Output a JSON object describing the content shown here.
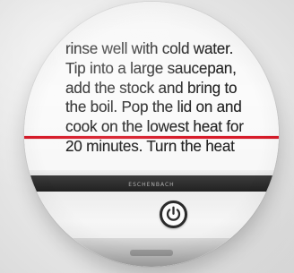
{
  "screen": {
    "lines": [
      "rinse well with cold water.",
      "Tip into a large saucepan,",
      "add the stock and bring to",
      "the boil. Pop the lid on and",
      "cook on the lowest heat for",
      "20 minutes. Turn the heat"
    ]
  },
  "device": {
    "brand": "ESCHENBACH"
  },
  "colors": {
    "guide_line": "#d71c2a",
    "text": "#232323",
    "bezel": "#2b2b2b"
  },
  "icons": {
    "power": "power-icon"
  }
}
